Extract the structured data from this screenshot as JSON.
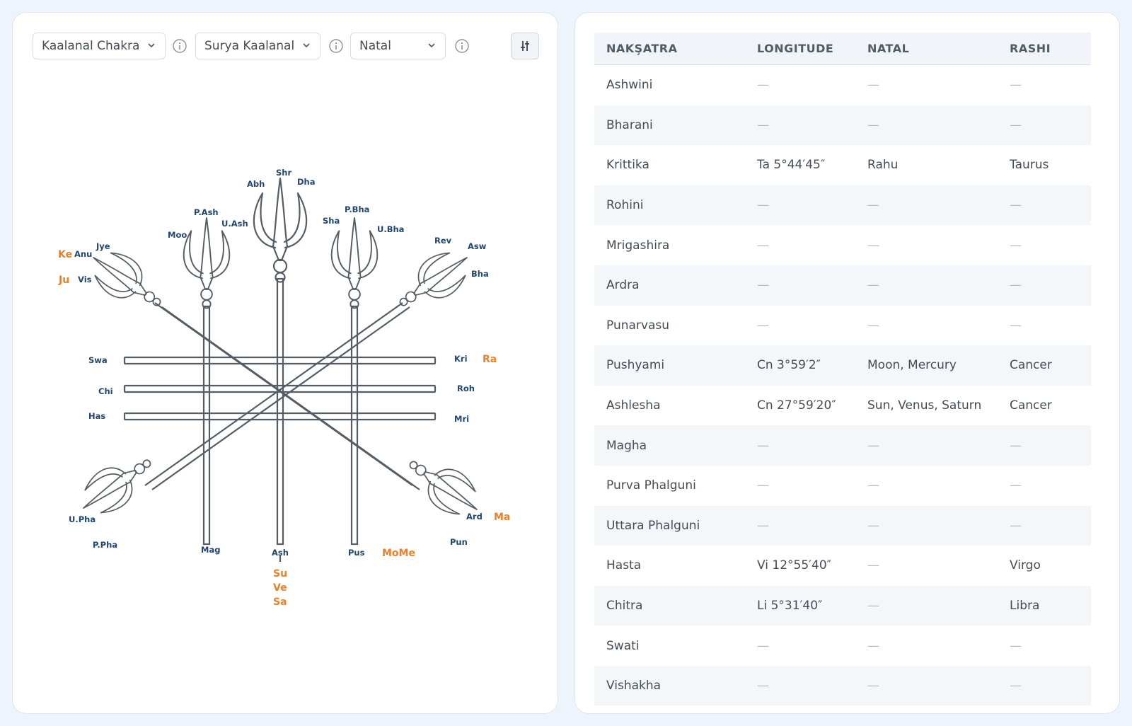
{
  "toolbar": {
    "chart_select": "Kaalanal Chakra",
    "variant_select": "Surya Kaalanal",
    "mode_select": "Natal"
  },
  "chakra": {
    "nakshatra_labels": {
      "shr": "Shr",
      "abh": "Abh",
      "dha": "Dha",
      "pash": "P.Ash",
      "uash": "U.Ash",
      "moo": "Moo",
      "sha": "Sha",
      "pbha": "P.Bha",
      "ubha": "U.Bha",
      "jye": "Jye",
      "anu": "Anu",
      "vis": "Vis",
      "rev": "Rev",
      "asw": "Asw",
      "bha": "Bha",
      "swa": "Swa",
      "chi": "Chi",
      "has": "Has",
      "kri": "Kri",
      "roh": "Roh",
      "mri": "Mri",
      "upha": "U.Pha",
      "ppha": "P.Pha",
      "mag": "Mag",
      "ash": "Ash",
      "pus": "Pus",
      "ard": "Ard",
      "pun": "Pun"
    },
    "planet_labels": {
      "ke": "Ke",
      "ju": "Ju",
      "ra": "Ra",
      "ma": "Ma",
      "mome": "MoMe",
      "su": "Su",
      "ve": "Ve",
      "sa": "Sa"
    }
  },
  "table": {
    "headers": [
      "NAKŞATRA",
      "LONGITUDE",
      "NATAL",
      "RASHI"
    ],
    "rows": [
      [
        "Ashwini",
        "—",
        "—",
        "—"
      ],
      [
        "Bharani",
        "—",
        "—",
        "—"
      ],
      [
        "Krittika",
        "Ta 5°44′45″",
        "Rahu",
        "Taurus"
      ],
      [
        "Rohini",
        "—",
        "—",
        "—"
      ],
      [
        "Mrigashira",
        "—",
        "—",
        "—"
      ],
      [
        "Ardra",
        "—",
        "—",
        "—"
      ],
      [
        "Punarvasu",
        "—",
        "—",
        "—"
      ],
      [
        "Pushyami",
        "Cn 3°59′2″",
        "Moon, Mercury",
        "Cancer"
      ],
      [
        "Ashlesha",
        "Cn 27°59′20″",
        "Sun, Venus, Saturn",
        "Cancer"
      ],
      [
        "Magha",
        "—",
        "—",
        "—"
      ],
      [
        "Purva Phalguni",
        "—",
        "—",
        "—"
      ],
      [
        "Uttara Phalguni",
        "—",
        "—",
        "—"
      ],
      [
        "Hasta",
        "Vi 12°55′40″",
        "—",
        "Virgo"
      ],
      [
        "Chitra",
        "Li 5°31′40″",
        "—",
        "Libra"
      ],
      [
        "Swati",
        "—",
        "—",
        "—"
      ],
      [
        "Vishakha",
        "—",
        "—",
        "—"
      ]
    ]
  }
}
